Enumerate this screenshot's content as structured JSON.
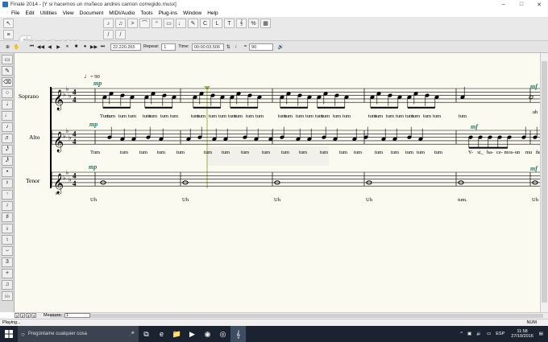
{
  "window": {
    "title": "Finale 2014 - [Y si hacemos un muñeco andres carrion corregido.musx]",
    "min": "–",
    "max": "□",
    "close": "✕"
  },
  "menu": [
    "File",
    "Edit",
    "Utilities",
    "View",
    "Document",
    "MIDI/Audio",
    "Tools",
    "Plug-ins",
    "Window",
    "Help"
  ],
  "watermark": "fiverr",
  "playback": {
    "counter": "22.220.265",
    "repeat_label": "Repeat:",
    "repeat_value": "1",
    "time_label": "Time:",
    "time_value": "00:00:03.506",
    "equals": "=",
    "tempo_value": "90"
  },
  "score": {
    "tempo_mark": "= 90",
    "staves": [
      {
        "name": "Soprano",
        "dynamic": "mp",
        "end_dynamic": "mf",
        "lyrics": [
          "Tum",
          "tum",
          "tum",
          "tum",
          "tum",
          "tum",
          "tum",
          "tum",
          "tum",
          "tum",
          "tum",
          "tum",
          "tum",
          "tum",
          "tum",
          "tum",
          "tum",
          "tum",
          "tum",
          "tum",
          "tum",
          "tum",
          "tum",
          "tum",
          "tum",
          "tum",
          "tum",
          "tum",
          "tum",
          "tum",
          "tum",
          "tum",
          "tum",
          "uh"
        ]
      },
      {
        "name": "Alto",
        "dynamic": "mp",
        "mid_dynamic": "mf",
        "lyrics": [
          "Tum",
          "tum",
          "tum",
          "tum",
          "tum",
          "tum",
          "tum",
          "tum",
          "tum",
          "tum",
          "tum",
          "tum",
          "tum",
          "tum",
          "tum",
          "tum",
          "tum",
          "tum",
          "tum",
          "Y-",
          "si_",
          "ha-",
          "ce-",
          "mos-",
          "un",
          "mu",
          "ñe"
        ]
      },
      {
        "name": "Tenor",
        "dynamic": "mp",
        "end_dynamic": "mf",
        "lyrics": [
          "Uh",
          "Uh",
          "Uh",
          "Uh",
          "tum.",
          "Uh"
        ]
      }
    ]
  },
  "measure_bar": {
    "pages": [
      "1",
      "2",
      "3",
      "4"
    ],
    "label": "Measure:",
    "value": "1"
  },
  "status": {
    "text": "Playing...",
    "num": "NUM"
  },
  "taskbar": {
    "search_placeholder": "Pregúntame cualquier cosa",
    "lang": "ESP",
    "time": "11:58",
    "date": "27/10/2016"
  },
  "colors": {
    "score_bg": "#fbfaf0",
    "dynamic": "#1d7a5e",
    "playhead": "#8fbc3c",
    "taskbar": "#1c2330"
  }
}
